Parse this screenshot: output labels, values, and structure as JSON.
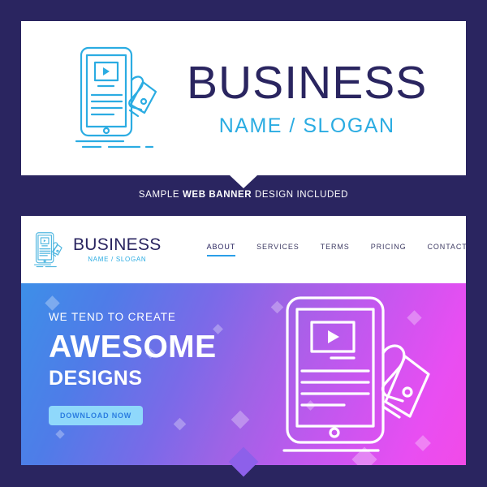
{
  "colors": {
    "background": "#2a2560",
    "card": "#ffffff",
    "brand_navy": "#2a2560",
    "brand_blue": "#2bace2",
    "nav_active_underline": "#2b9fe8",
    "cta_background": "#8fd8fb",
    "cta_text": "#2b7de0",
    "hero_gradient_start": "#3d8fe8",
    "hero_gradient_end": "#f24ae8"
  },
  "logo_card": {
    "brand_name": "BUSINESS",
    "brand_slogan": "NAME / SLOGAN",
    "icon": "tablet-in-hand-icon"
  },
  "sample_caption": {
    "prefix": "SAMPLE ",
    "emphasis": "WEB BANNER",
    "suffix": " DESIGN INCLUDED"
  },
  "banner": {
    "nav": {
      "logo_icon": "tablet-in-hand-icon",
      "brand_name": "BUSINESS",
      "brand_slogan": "NAME / SLOGAN",
      "links": [
        {
          "label": "ABOUT",
          "active": true
        },
        {
          "label": "SERVICES",
          "active": false
        },
        {
          "label": "TERMS",
          "active": false
        },
        {
          "label": "PRICING",
          "active": false
        },
        {
          "label": "CONTACT",
          "active": false
        }
      ]
    },
    "hero": {
      "eyebrow": "WE TEND TO CREATE",
      "headline": "AWESOME",
      "subheadline": "DESIGNS",
      "cta_label": "DOWNLOAD NOW",
      "illustration": "tablet-in-hand-icon"
    }
  }
}
